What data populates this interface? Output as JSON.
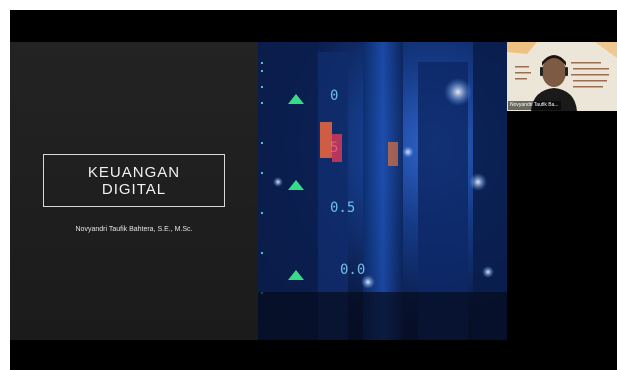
{
  "slide": {
    "title_line1": "KEUANGAN",
    "title_line2": "DIGITAL",
    "author": "Novyandri Taufik Bahtera, S.E., M.Sc."
  },
  "participant": {
    "name": "Novyandri Taufik Ba..."
  },
  "colors": {
    "background": "#000000",
    "slide_dark": "#1e1e1e",
    "title_border": "#d8d8d8",
    "city_blue": "#2f63c9"
  }
}
